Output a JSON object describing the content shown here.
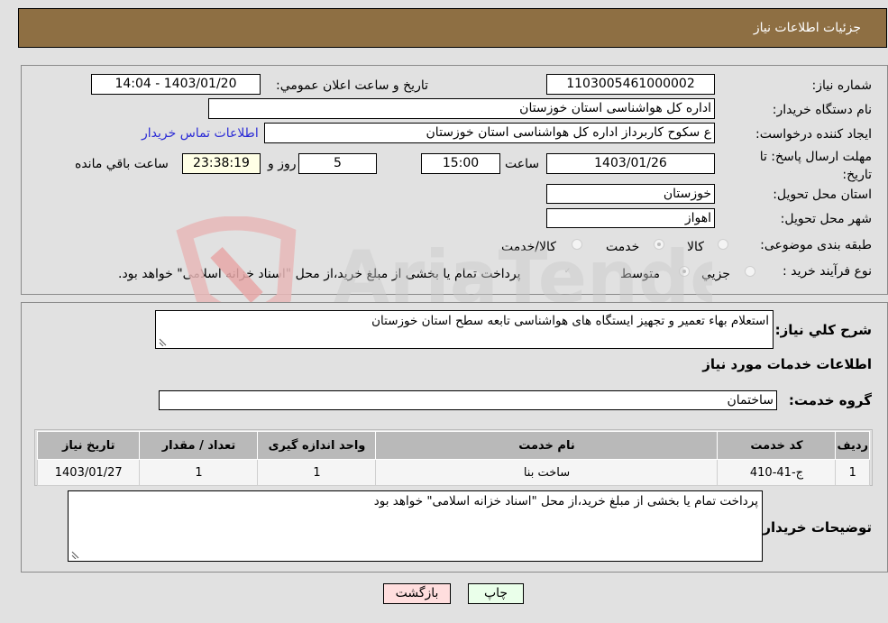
{
  "header": {
    "title": "جزئیات اطلاعات نیاز"
  },
  "fields": {
    "need_number": {
      "label": "شماره نیاز:",
      "value": "1103005461000002"
    },
    "announce_datetime": {
      "label": "تاریخ و ساعت اعلان عمومي:",
      "value": "1403/01/20 - 14:04"
    },
    "buyer_org": {
      "label": "نام دستگاه خریدار:",
      "value": "اداره کل هواشناسی استان خوزستان"
    },
    "requester": {
      "label": "ایجاد کننده درخواست:",
      "value": "ع سکوح کاربرداز اداره کل هواشناسی استان خوزستان"
    },
    "buyer_contact_link": "اطلاعات تماس خریدار",
    "deadline": {
      "label": "مهلت ارسال پاسخ: تا تاریخ:",
      "date": "1403/01/26",
      "time_label": "ساعت",
      "time": "15:00",
      "days": "5",
      "days_label": "روز و",
      "remaining": "23:38:19",
      "remaining_label": "ساعت باقي مانده"
    },
    "province": {
      "label": "استان محل تحویل:",
      "value": "خوزستان"
    },
    "city": {
      "label": "شهر محل تحویل:",
      "value": "اهواز"
    },
    "category": {
      "label": "طبقه بندی موضوعی:",
      "options": [
        "کالا",
        "خدمت",
        "کالا/خدمت"
      ],
      "selected": "خدمت"
    },
    "process_type": {
      "label": "نوع فرآیند خرید :",
      "options": [
        "جزیي",
        "متوسط"
      ],
      "selected": "متوسط",
      "checkbox_label": "پرداخت تمام یا بخشی از مبلغ خرید،از محل \"اسناد خزانه اسلامی\" خواهد بود.",
      "checkbox_checked": true
    }
  },
  "description": {
    "label": "شرح کلي نیاز:",
    "value": "استعلام بهاء تعمیر و تجهیز ایستگاه های هواشناسی تابعه سطح استان خوزستان"
  },
  "services_section_title": "اطلاعات خدمات مورد نیاز",
  "service_group": {
    "label": "گروه خدمت:",
    "value": "ساختمان"
  },
  "table": {
    "columns": [
      "ردیف",
      "کد خدمت",
      "نام خدمت",
      "واحد اندازه گیری",
      "تعداد / مقدار",
      "تاریخ نیاز"
    ],
    "rows": [
      [
        "1",
        "ج-41-410",
        "ساخت بنا",
        "1",
        "1",
        "1403/01/27"
      ]
    ]
  },
  "buyer_notes": {
    "label": "توضیحات خریدار:",
    "value": "پرداخت تمام یا بخشی از مبلغ خرید،از محل \"اسناد خزانه اسلامی\" خواهد بود"
  },
  "buttons": {
    "print": "چاپ",
    "back": "بازگشت"
  },
  "colors": {
    "header_bg": "#8e6f43",
    "link": "#2b2bd6",
    "print_btn_bg": "#eaffea",
    "back_btn_bg": "#ffdede"
  }
}
